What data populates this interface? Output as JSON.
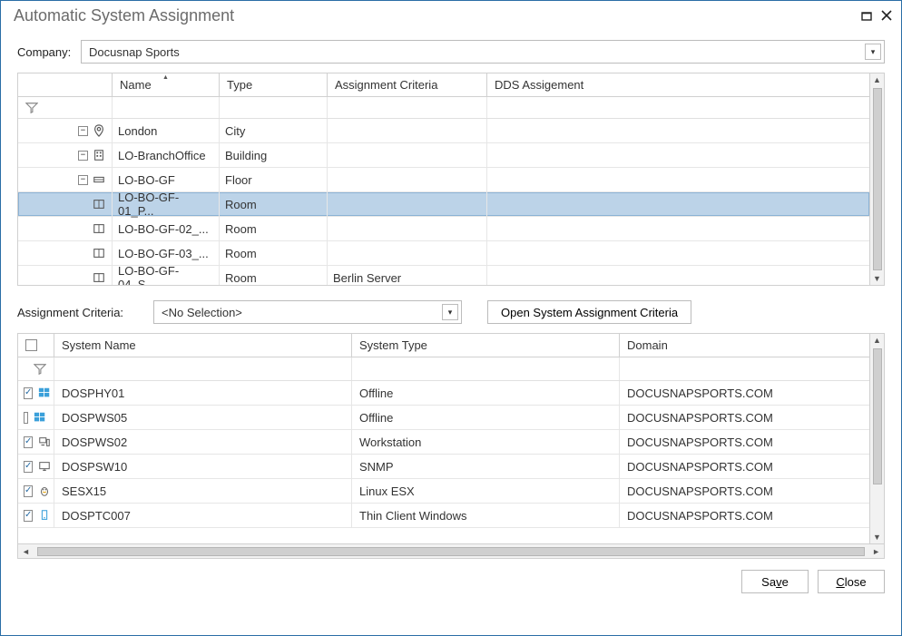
{
  "window": {
    "title": "Automatic System Assignment"
  },
  "company": {
    "label": "Company:",
    "value": "Docusnap Sports"
  },
  "tree": {
    "headers": {
      "name": "Name",
      "type": "Type",
      "criteria": "Assignment Criteria",
      "dds": "DDS Assigement"
    },
    "rows": [
      {
        "indent": 0,
        "expander": "-",
        "icon": "pin-icon",
        "name": "London",
        "type": "City",
        "criteria": "",
        "selected": false
      },
      {
        "indent": 1,
        "expander": "-",
        "icon": "building-icon",
        "name": "LO-BranchOffice",
        "type": "Building",
        "criteria": "",
        "selected": false
      },
      {
        "indent": 2,
        "expander": "-",
        "icon": "floor-icon",
        "name": "LO-BO-GF",
        "type": "Floor",
        "criteria": "",
        "selected": false
      },
      {
        "indent": 3,
        "expander": "",
        "icon": "room-icon",
        "name": "LO-BO-GF-01_P...",
        "type": "Room",
        "criteria": "",
        "selected": true
      },
      {
        "indent": 3,
        "expander": "",
        "icon": "room-icon",
        "name": "LO-BO-GF-02_...",
        "type": "Room",
        "criteria": "",
        "selected": false
      },
      {
        "indent": 3,
        "expander": "",
        "icon": "room-icon",
        "name": "LO-BO-GF-03_...",
        "type": "Room",
        "criteria": "",
        "selected": false
      },
      {
        "indent": 3,
        "expander": "",
        "icon": "room-icon",
        "name": "LO-BO-GF-04_S...",
        "type": "Room",
        "criteria": "Berlin Server",
        "selected": false
      }
    ]
  },
  "criteria": {
    "label": "Assignment Criteria:",
    "value": "<No Selection>",
    "open_button": "Open System Assignment Criteria"
  },
  "systems": {
    "headers": {
      "name": "System Name",
      "type": "System Type",
      "domain": "Domain"
    },
    "rows": [
      {
        "checked": true,
        "icon": "windows-icon",
        "name": "DOSPHY01",
        "type": "Offline",
        "domain": "DOCUSNAPSPORTS.COM"
      },
      {
        "checked": false,
        "icon": "windows-icon",
        "name": "DOSPWS05",
        "type": "Offline",
        "domain": "DOCUSNAPSPORTS.COM"
      },
      {
        "checked": true,
        "icon": "workstation-icon",
        "name": "DOSPWS02",
        "type": "Workstation",
        "domain": "DOCUSNAPSPORTS.COM"
      },
      {
        "checked": true,
        "icon": "monitor-icon",
        "name": "DOSPSW10",
        "type": "SNMP",
        "domain": "DOCUSNAPSPORTS.COM"
      },
      {
        "checked": true,
        "icon": "linux-icon",
        "name": "SESX15",
        "type": "Linux ESX",
        "domain": "DOCUSNAPSPORTS.COM"
      },
      {
        "checked": true,
        "icon": "thinclient-icon",
        "name": "DOSPTC007",
        "type": "Thin Client Windows",
        "domain": "DOCUSNAPSPORTS.COM"
      }
    ]
  },
  "footer": {
    "save": "Save",
    "close": "Close"
  }
}
